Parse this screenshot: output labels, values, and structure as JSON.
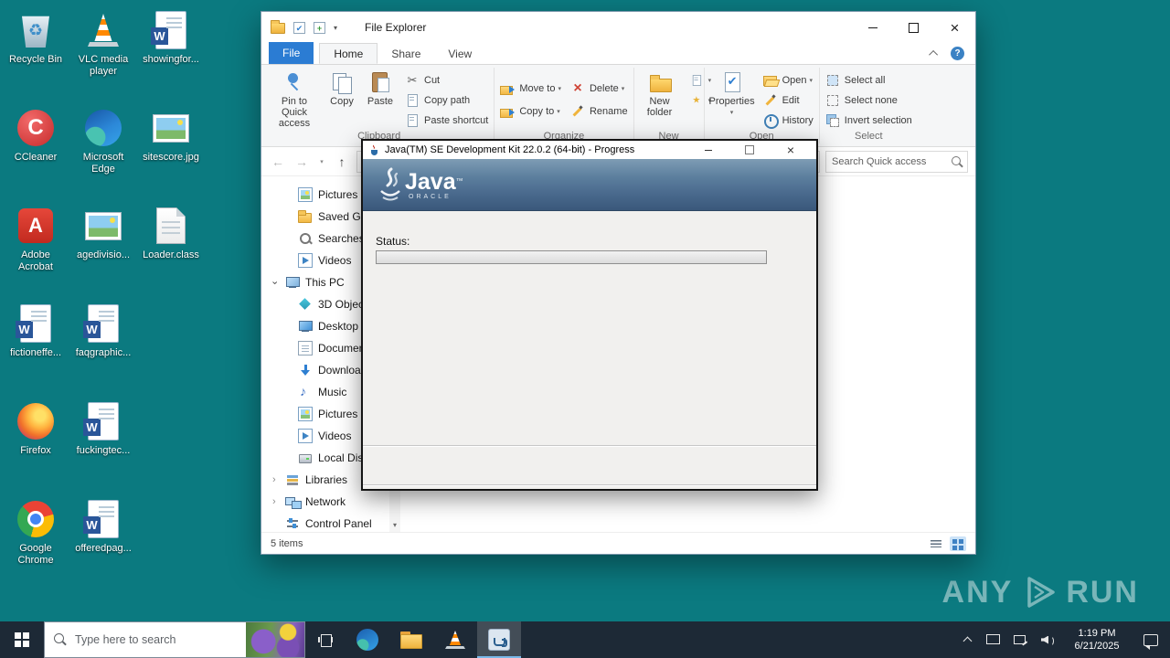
{
  "desktop": {
    "icons": [
      {
        "label": "Recycle Bin"
      },
      {
        "label": "CCleaner"
      },
      {
        "label": "Adobe Acrobat"
      },
      {
        "label": "fictioneffe..."
      },
      {
        "label": "Firefox"
      },
      {
        "label": "Google Chrome"
      },
      {
        "label": "VLC media player"
      },
      {
        "label": "Microsoft Edge"
      },
      {
        "label": "agedivisio..."
      },
      {
        "label": "faqgraphic..."
      },
      {
        "label": "fuckingtec..."
      },
      {
        "label": "offeredpag..."
      },
      {
        "label": "showingfor..."
      },
      {
        "label": "sitescore.jpg"
      },
      {
        "label": "Loader.class"
      }
    ],
    "watermark_any": "ANY",
    "watermark_run": "RUN"
  },
  "explorer": {
    "title": "File Explorer",
    "tab_file": "File",
    "tab_home": "Home",
    "tab_share": "Share",
    "tab_view": "View",
    "ribbon": {
      "pin": "Pin to Quick access",
      "copy": "Copy",
      "paste": "Paste",
      "cut": "Cut",
      "copy_path": "Copy path",
      "paste_shortcut": "Paste shortcut",
      "move_to": "Move to",
      "copy_to": "Copy to",
      "delete": "Delete",
      "rename": "Rename",
      "new_folder": "New folder",
      "properties": "Properties",
      "open": "Open",
      "edit": "Edit",
      "history": "History",
      "select_all": "Select all",
      "select_none": "Select none",
      "invert_selection": "Invert selection",
      "group_clipboard": "Clipboard",
      "group_organize": "Organize",
      "group_new": "New",
      "group_open": "Open",
      "group_select": "Select"
    },
    "search_placeholder": "Search Quick access",
    "sidebar": [
      {
        "label": "Pictures"
      },
      {
        "label": "Saved Games"
      },
      {
        "label": "Searches"
      },
      {
        "label": "Videos"
      },
      {
        "label": "This PC"
      },
      {
        "label": "3D Objects"
      },
      {
        "label": "Desktop"
      },
      {
        "label": "Documents"
      },
      {
        "label": "Downloads"
      },
      {
        "label": "Music"
      },
      {
        "label": "Pictures"
      },
      {
        "label": "Videos"
      },
      {
        "label": "Local Disk (C:)"
      },
      {
        "label": "Libraries"
      },
      {
        "label": "Network"
      },
      {
        "label": "Control Panel"
      }
    ],
    "status_items": "5 items"
  },
  "dialog": {
    "title": "Java(TM) SE Development Kit 22.0.2 (64-bit) - Progress",
    "brand_java": "Java",
    "brand_tm": "™",
    "brand_oracle": "ORACLE",
    "status_label": "Status:"
  },
  "taskbar": {
    "search_placeholder": "Type here to search",
    "time": "1:19 PM",
    "date": "6/21/2025"
  }
}
